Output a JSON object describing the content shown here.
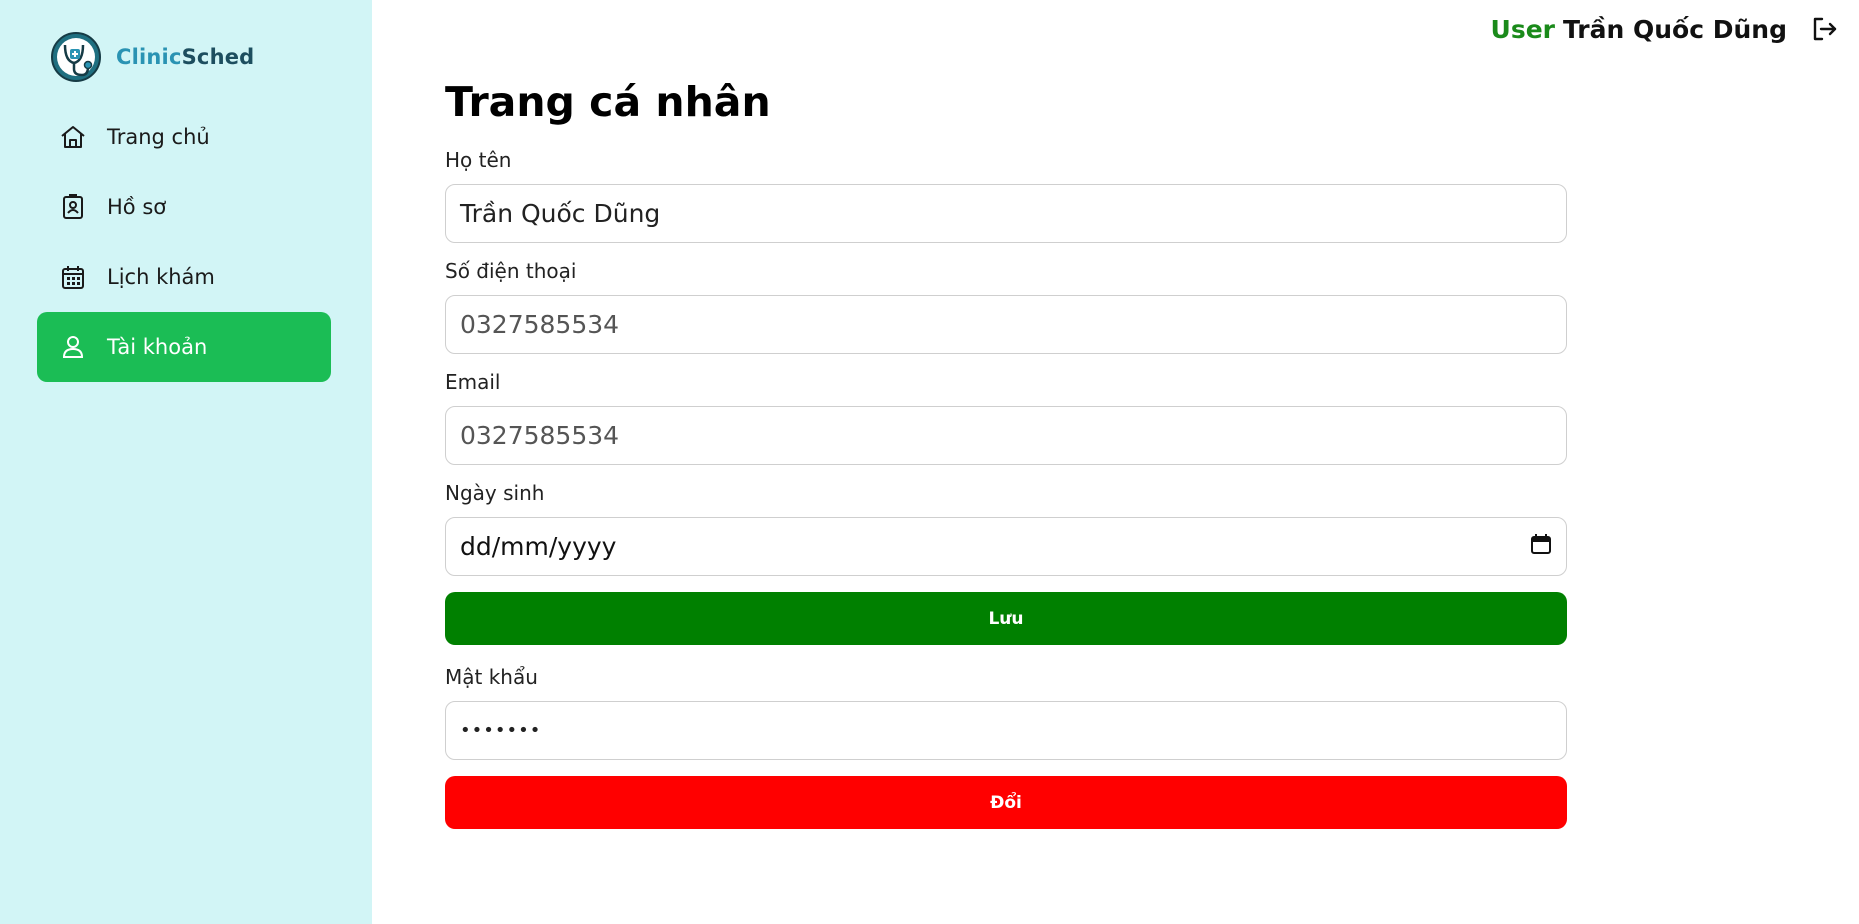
{
  "app": {
    "brand_part1": "Clinic",
    "brand_part2": "Sched"
  },
  "sidebar": {
    "items": [
      {
        "label": "Trang chủ",
        "icon": "home-icon",
        "active": false
      },
      {
        "label": "Hồ sơ",
        "icon": "id-badge-icon",
        "active": false
      },
      {
        "label": "Lịch khám",
        "icon": "calendar-icon",
        "active": false
      },
      {
        "label": "Tài khoản",
        "icon": "user-icon",
        "active": true
      }
    ]
  },
  "header": {
    "user_prefix": "User",
    "user_name": "Trần Quốc Dũng",
    "logout_icon": "logout-icon"
  },
  "main": {
    "title": "Trang cá nhân",
    "fields": {
      "fullname": {
        "label": "Họ tên",
        "value": "Trần Quốc Dũng"
      },
      "phone": {
        "label": "Số điện thoại",
        "value": "0327585534"
      },
      "email": {
        "label": "Email",
        "value": "0327585534"
      },
      "dob": {
        "label": "Ngày sinh",
        "value": "dd/mm/yyyy"
      },
      "password": {
        "label": "Mật khẩu",
        "value": "•••••••"
      }
    },
    "save_label": "Lưu",
    "change_label": "Đổi"
  },
  "colors": {
    "sidebar_bg": "#d2f5f6",
    "active_nav": "#1bbd55",
    "save_button": "#008000",
    "change_button": "#ff0000",
    "user_prefix": "#1a8a1a"
  }
}
